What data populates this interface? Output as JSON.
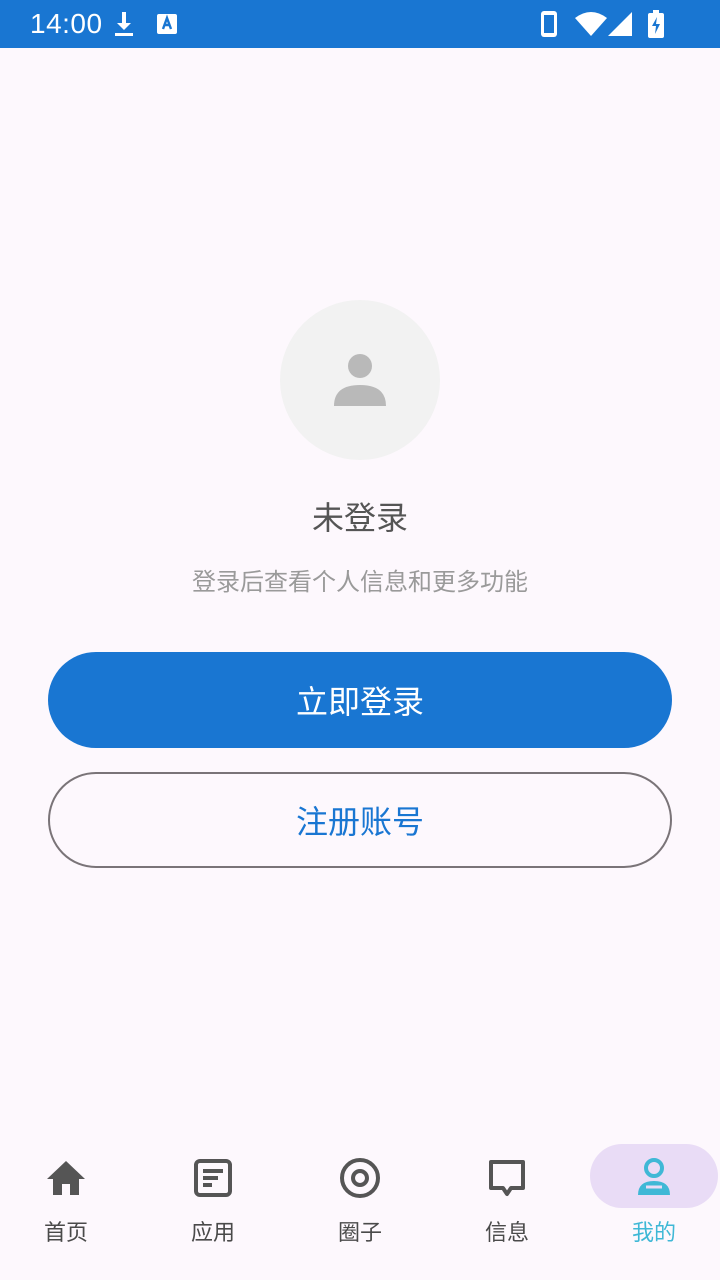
{
  "status_bar": {
    "time": "14:00",
    "icons": [
      "download-icon",
      "keyboard-a-icon",
      "phone-icon",
      "wifi-icon",
      "signal-icon",
      "battery-charging-icon"
    ]
  },
  "profile": {
    "avatar_icon": "person-icon",
    "status_text": "未登录",
    "hint_text": "登录后查看个人信息和更多功能"
  },
  "actions": {
    "login_label": "立即登录",
    "register_label": "注册账号"
  },
  "bottom_nav": {
    "items": [
      {
        "label": "首页",
        "icon": "home-icon"
      },
      {
        "label": "应用",
        "icon": "article-icon"
      },
      {
        "label": "圈子",
        "icon": "circle-icon"
      },
      {
        "label": "信息",
        "icon": "message-icon"
      },
      {
        "label": "我的",
        "icon": "person-icon",
        "active": true
      }
    ]
  },
  "colors": {
    "primary": "#1976d2",
    "background": "#fdf8fd",
    "active_nav": "#3fb8d6",
    "active_pill": "#e9dcf6"
  }
}
